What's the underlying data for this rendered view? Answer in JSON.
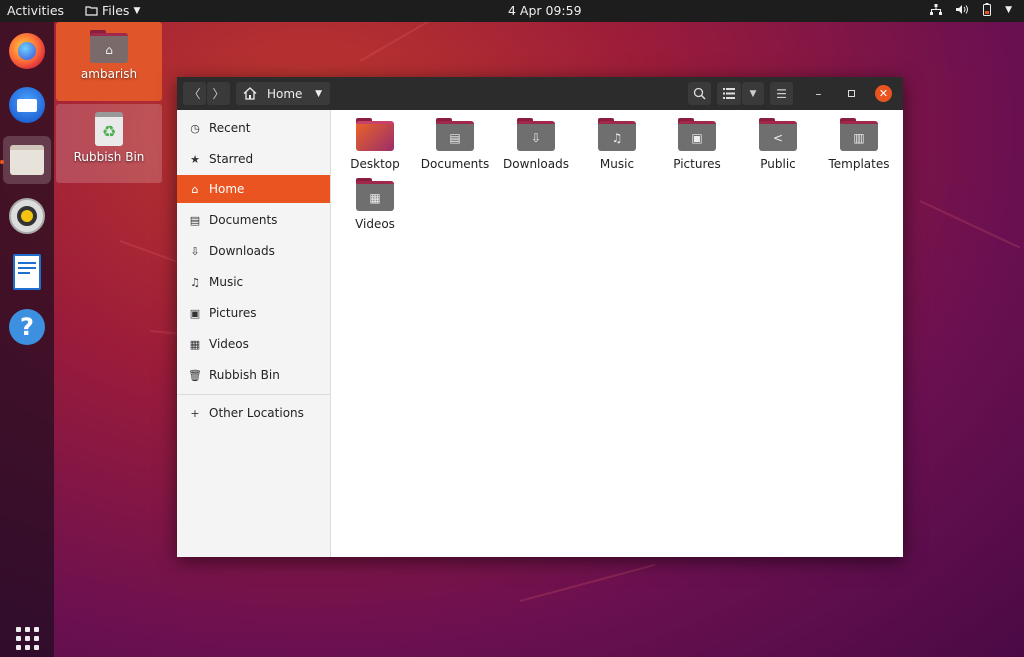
{
  "topbar": {
    "activities": "Activities",
    "app_name": "Files",
    "clock": "4 Apr  09:59"
  },
  "dock": {
    "apps": [
      "firefox-icon",
      "thunderbird-icon",
      "files-icon",
      "rhythmbox-icon",
      "writer-icon",
      "help-icon"
    ],
    "show_apps_icon": "show-applications-icon"
  },
  "desktop": {
    "icons": [
      {
        "label": "ambarish",
        "icon": "home-folder-icon"
      },
      {
        "label": "Rubbish Bin",
        "icon": "trash-icon"
      }
    ]
  },
  "window": {
    "path": "Home",
    "sidebar": {
      "items": [
        {
          "label": "Recent",
          "icon": "clock-icon"
        },
        {
          "label": "Starred",
          "icon": "star-icon"
        },
        {
          "label": "Home",
          "icon": "home-icon"
        },
        {
          "label": "Documents",
          "icon": "document-icon"
        },
        {
          "label": "Downloads",
          "icon": "download-icon"
        },
        {
          "label": "Music",
          "icon": "music-icon"
        },
        {
          "label": "Pictures",
          "icon": "picture-icon"
        },
        {
          "label": "Videos",
          "icon": "video-icon"
        },
        {
          "label": "Rubbish Bin",
          "icon": "trash-icon"
        }
      ],
      "other": {
        "label": "Other Locations",
        "icon": "plus-icon"
      }
    },
    "folders": [
      {
        "label": "Desktop",
        "glyph": ""
      },
      {
        "label": "Documents",
        "glyph": "▤"
      },
      {
        "label": "Downloads",
        "glyph": "⇩"
      },
      {
        "label": "Music",
        "glyph": "♫"
      },
      {
        "label": "Pictures",
        "glyph": "▣"
      },
      {
        "label": "Public",
        "glyph": "<"
      },
      {
        "label": "Templates",
        "glyph": "▥"
      },
      {
        "label": "Videos",
        "glyph": "▦"
      }
    ]
  },
  "colors": {
    "accent": "#e95420",
    "headerbar": "#2c2c2c",
    "topbar": "#1d1d1d"
  }
}
